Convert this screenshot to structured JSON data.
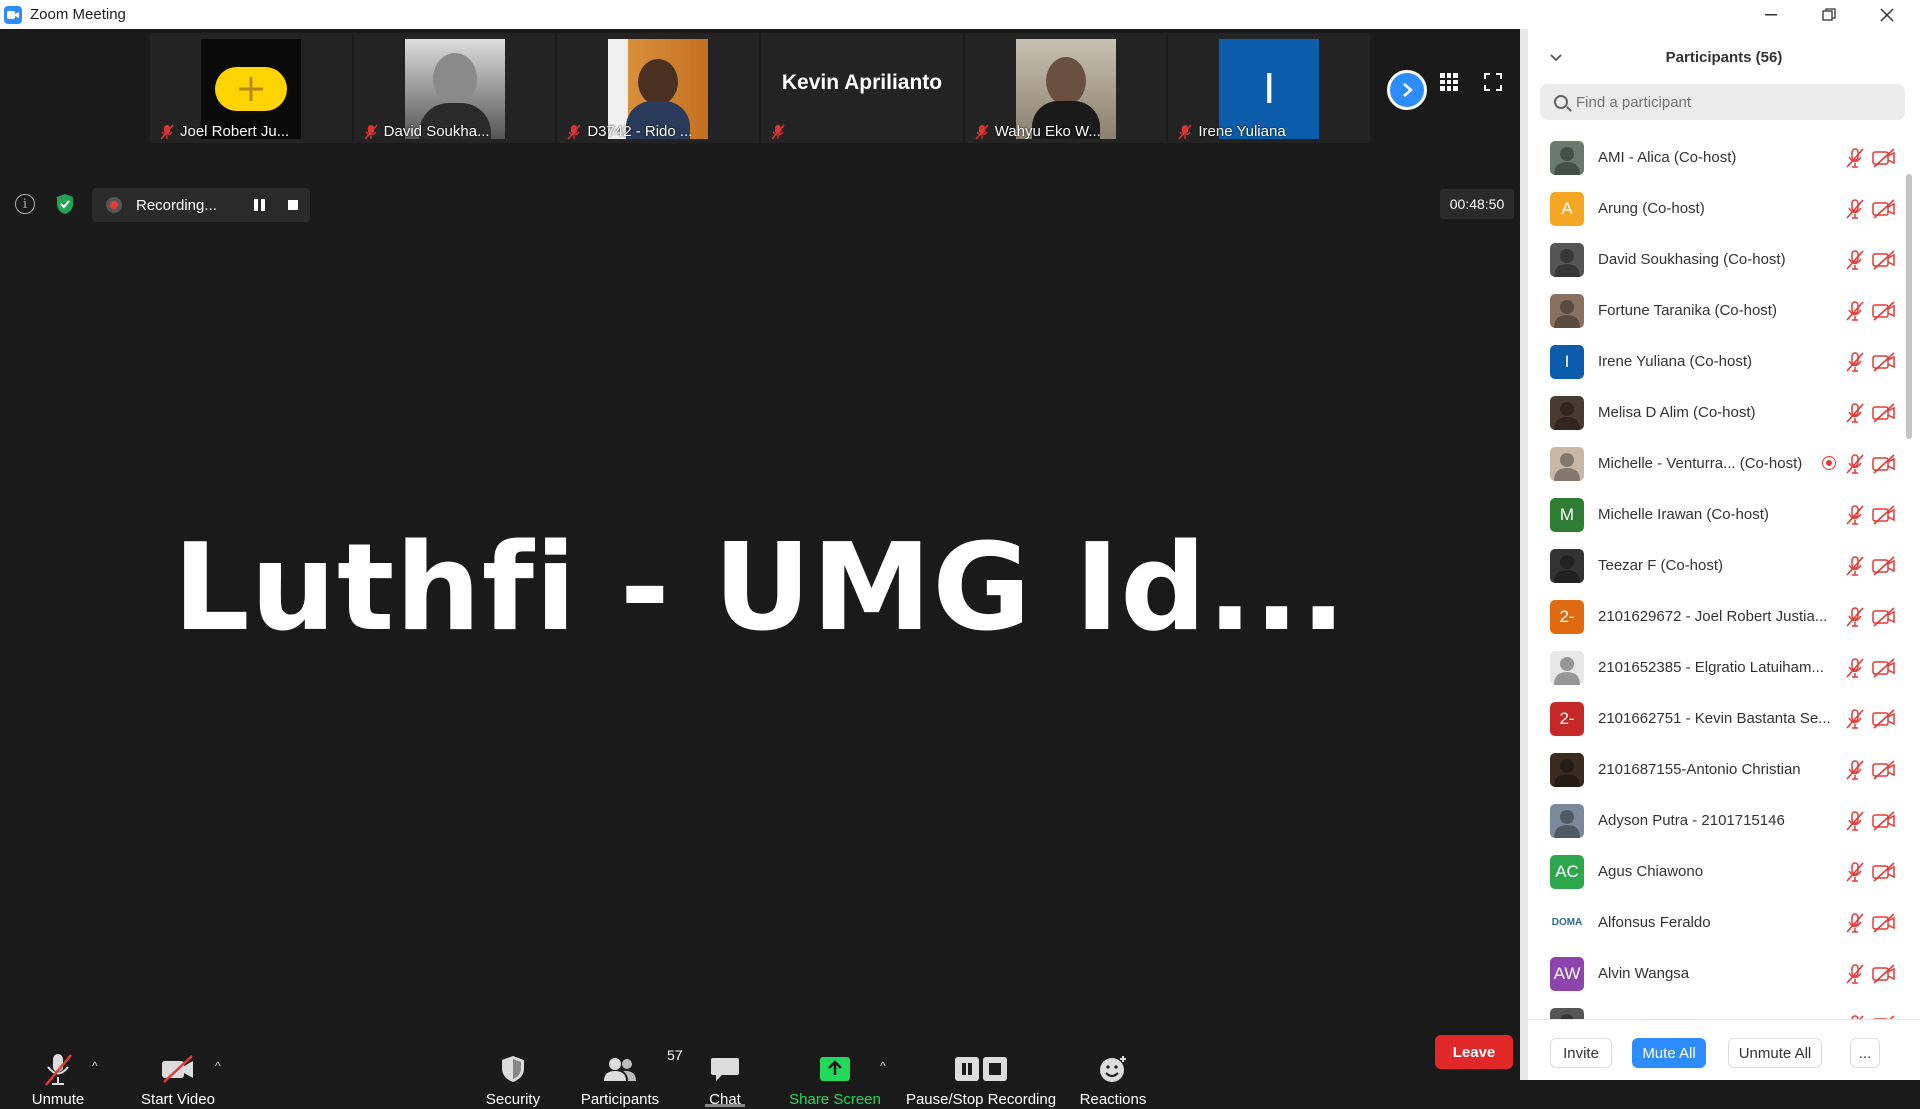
{
  "window": {
    "title": "Zoom Meeting",
    "controls": [
      "minimize",
      "restore",
      "close"
    ]
  },
  "thumbnails": [
    {
      "name": "Joel Robert Ju...",
      "muted": true,
      "image": "yellow-plus"
    },
    {
      "name": "David Soukha...",
      "muted": true,
      "image": "photo"
    },
    {
      "name": "D3742 - Rido ...",
      "muted": true,
      "image": "photo"
    },
    {
      "name": "Kevin Aprilianto",
      "muted": true,
      "image": "name-only"
    },
    {
      "name": "Wahyu Eko W...",
      "muted": true,
      "image": "photo"
    },
    {
      "name": "Irene Yuliana",
      "muted": true,
      "image": "letter",
      "letter": "I"
    }
  ],
  "recording": {
    "label": "Recording..."
  },
  "timer": "00:48:50",
  "active_speaker": "Luthfi - UMG Id...",
  "toolbar": {
    "unmute": "Unmute",
    "start_video": "Start Video",
    "security": "Security",
    "participants": "Participants",
    "participants_count": "57",
    "chat": "Chat",
    "share_screen": "Share Screen",
    "pause_stop": "Pause/Stop Recording",
    "reactions": "Reactions",
    "leave": "Leave"
  },
  "colors": {
    "accent": "#2d8cff",
    "share_green": "#23d959",
    "leave_red": "#e02828",
    "recording_red": "#e53935"
  },
  "panel": {
    "title": "Participants (56)",
    "search_placeholder": "Find a participant",
    "participants": [
      {
        "name": "AMI - Alica (Co-host)",
        "avatar": "photo",
        "color": "#6b7b6b"
      },
      {
        "name": "Arung (Co-host)",
        "avatar": "A",
        "color": "#f5a623"
      },
      {
        "name": "David Soukhasing (Co-host)",
        "avatar": "photo",
        "color": "#555"
      },
      {
        "name": "Fortune Taranika (Co-host)",
        "avatar": "photo",
        "color": "#8a7060"
      },
      {
        "name": "Irene Yuliana (Co-host)",
        "avatar": "I",
        "color": "#0b5cab"
      },
      {
        "name": "Melisa D Alim (Co-host)",
        "avatar": "photo",
        "color": "#4a3a30"
      },
      {
        "name": "Michelle - Venturra... (Co-host)",
        "avatar": "photo",
        "color": "#c9b8a6",
        "recording": true
      },
      {
        "name": "Michelle Irawan (Co-host)",
        "avatar": "M",
        "color": "#2e7d32"
      },
      {
        "name": "Teezar F (Co-host)",
        "avatar": "photo",
        "color": "#333"
      },
      {
        "name": "2101629672 - Joel Robert Justia...",
        "avatar": "2-",
        "color": "#e06a10"
      },
      {
        "name": "2101652385 - Elgratio Latuiham...",
        "avatar": "photo",
        "color": "#e8e8e8"
      },
      {
        "name": "2101662751 - Kevin Bastanta Se...",
        "avatar": "2-",
        "color": "#c62828"
      },
      {
        "name": "2101687155-Antonio Christian",
        "avatar": "photo",
        "color": "#3b2a20"
      },
      {
        "name": "Adyson Putra - 2101715146",
        "avatar": "photo",
        "color": "#7a8a9a"
      },
      {
        "name": "Agus Chiawono",
        "avatar": "AC",
        "color": "#2ea84f"
      },
      {
        "name": "Alfonsus Feraldo",
        "avatar": "DOMA",
        "color": "#ffffff"
      },
      {
        "name": "Alvin Wangsa",
        "avatar": "AW",
        "color": "#8e44ad"
      },
      {
        "name": "",
        "avatar": "photo",
        "color": "#555"
      }
    ],
    "buttons": {
      "invite": "Invite",
      "mute_all": "Mute All",
      "unmute_all": "Unmute All",
      "more": "..."
    }
  }
}
